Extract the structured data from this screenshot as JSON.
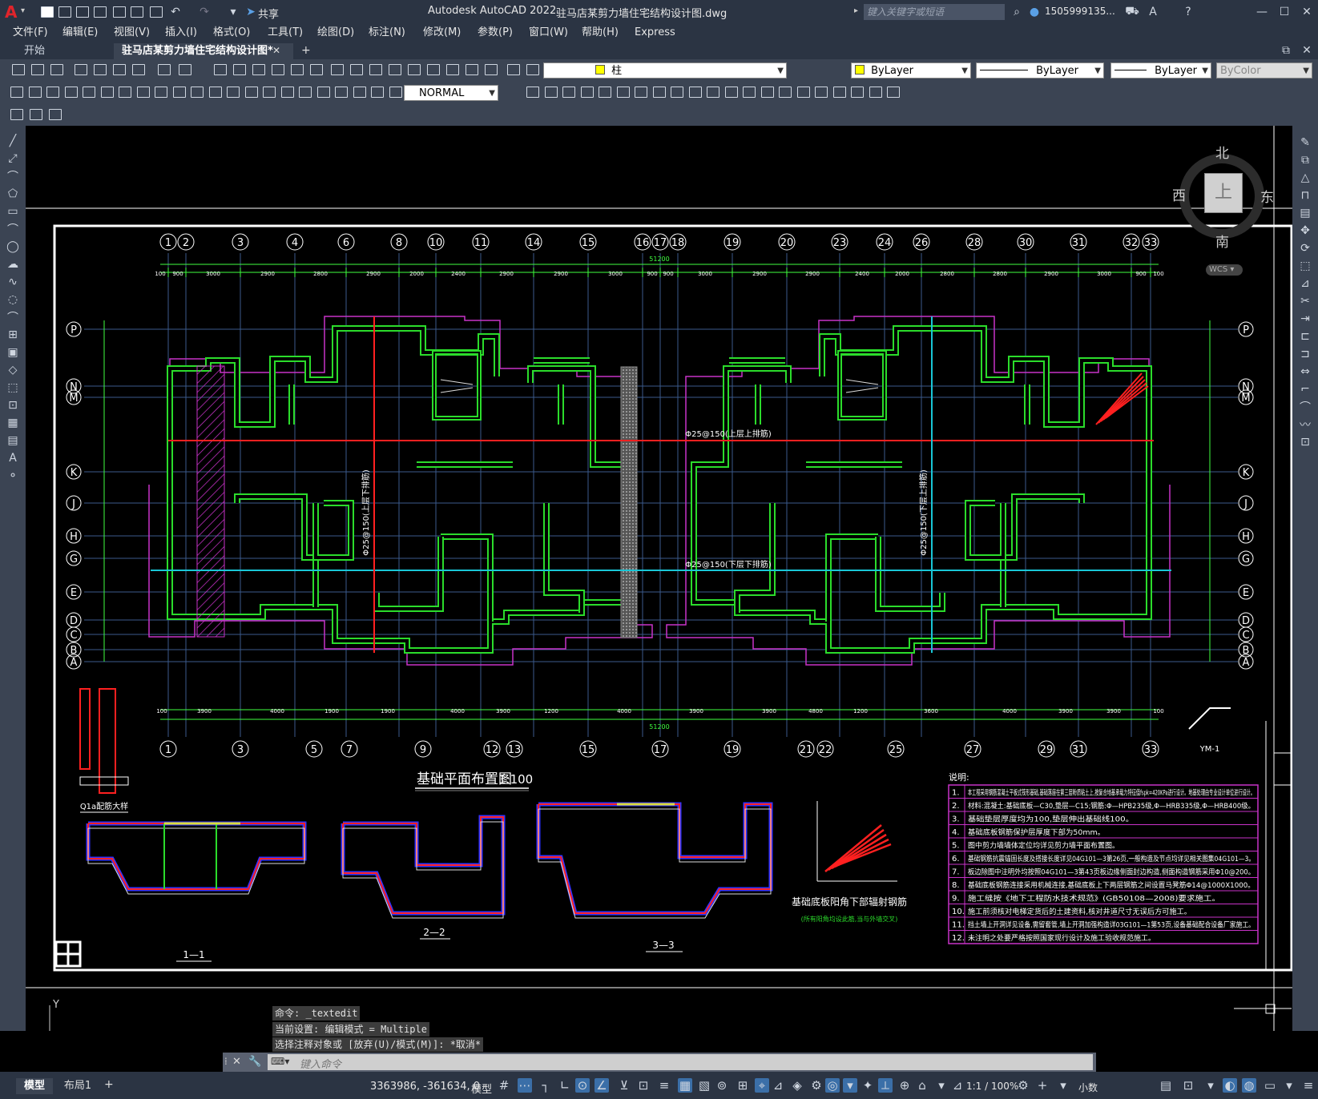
{
  "app": {
    "logo": "A",
    "title": "Autodesk AutoCAD 2022",
    "document_title": "驻马店某剪力墙住宅结构设计图.dwg",
    "share_label": "共享",
    "search_placeholder": "键入关键字或短语",
    "user_name": "1505999135...",
    "colors": {
      "titlebar": "#2b3443",
      "toolbar": "#3b4453",
      "canvas": "#000000",
      "accent": "#3b6fa8"
    }
  },
  "menu": [
    "文件(F)",
    "编辑(E)",
    "视图(V)",
    "插入(I)",
    "格式(O)",
    "工具(T)",
    "绘图(D)",
    "标注(N)",
    "修改(M)",
    "参数(P)",
    "窗口(W)",
    "帮助(H)",
    "Express"
  ],
  "tabs": [
    {
      "label": "开始",
      "active": false
    },
    {
      "label": "驻马店某剪力墙住宅结构设计图*",
      "active": true
    }
  ],
  "toolbar": {
    "layer_value": "柱",
    "color_value": "ByLayer",
    "linetype_value": "ByLayer",
    "lineweight_value": "ByLayer",
    "plotstyle_value": "ByColor",
    "dimstyle_value": "NORMAL"
  },
  "viewcube": {
    "north": "北",
    "south": "南",
    "east": "东",
    "west": "西",
    "top": "上",
    "wcs": "WCS"
  },
  "drawing": {
    "plan_title": "基础平面布置图",
    "plan_scale": "1:100",
    "top_axes": [
      "1",
      "2",
      "3",
      "4",
      "6",
      "8",
      "10",
      "11",
      "14",
      "15",
      "16",
      "17",
      "18",
      "19",
      "20",
      "23",
      "24",
      "26",
      "28",
      "30",
      "31",
      "32",
      "33"
    ],
    "bottom_axes": [
      "1",
      "3",
      "5",
      "7",
      "9",
      "12",
      "13",
      "15",
      "17",
      "19",
      "21",
      "22",
      "25",
      "27",
      "29",
      "31",
      "33"
    ],
    "row_axes": [
      "P",
      "N",
      "M",
      "K",
      "J",
      "H",
      "G",
      "E",
      "D",
      "C",
      "B",
      "A"
    ],
    "top_dims": [
      "100",
      "900",
      "3000",
      "2900",
      "2800",
      "2900",
      "2000",
      "2400",
      "2900",
      "2900",
      "3000",
      "900",
      "900",
      "3000",
      "2900",
      "2900",
      "2400",
      "2000",
      "2800",
      "2800",
      "2900",
      "3000",
      "900",
      "100"
    ],
    "bottom_dims": [
      "100",
      "3900",
      "4000",
      "1900",
      "1900",
      "4000",
      "3900",
      "1200",
      "4000",
      "3900",
      "3900",
      "4800",
      "1200",
      "3600",
      "4000",
      "3900",
      "3900",
      "100"
    ],
    "total_dim": "51200",
    "rebar_labels": [
      "Φ25@150(上层上排筋)",
      "Φ25@150(下层下排筋)",
      "Φ25@150(上层下排筋)",
      "Φ25@150(下层上排筋)"
    ],
    "sections": [
      "1—1",
      "2—2",
      "3—3"
    ],
    "corner_detail_title": "基础底板阳角下部辐射钢筋",
    "corner_detail_sub": "(所有阳角均设此筋,当与外墙交叉)",
    "q1a_title": "Q1a配筋大样",
    "ym_title": "YM-1",
    "notes_title": "说明:",
    "notes": [
      "本工程采用钢筋混凝土平板式筏形基础,基础落座在第三层粉质粘土上,按复合地基承载力特征值fspk=420KPa进行设计。地基处理由专业设计单位进行设计。",
      "材料:混凝土:基础底板—C30,垫层—C15;钢筋:Φ—HPB235级,Φ—HRB335级,Φ—HRB400级。",
      "基础垫层厚度均为100,垫层伸出基础线100。",
      "基础底板钢筋保护层厚度下部为50mm。",
      "图中剪力墙墙体定位均详见剪力墙平面布置图。",
      "基础钢筋抗震锚固长度及搭接长度详见04G101—3第26页,一般构造及节点均详见相关图集04G101—3。",
      "板边除图中注明外均按照04G101—3第43页板边缘侧面封边构造,侧面构造钢筋采用Φ10@200。",
      "基础底板钢筋连接采用机械连接,基础底板上下两层钢筋之间设置马凳筋Φ14@1000X1000。",
      "施工缝按《地下工程防水技术规范》(GB50108—2008)要求施工。",
      "施工前须核对电梯定货后的土建资料,核对井道尺寸无误后方可施工。",
      "挡土墙上开洞详见设备,需留套管,墙上开洞加强构造详03G101—1第53页,设备基础配合设备厂家施工。",
      "未注明之处要严格按照国家现行设计及施工验收规范施工。"
    ]
  },
  "command": {
    "history": [
      "命令: _textedit",
      "当前设置: 编辑模式 = Multiple",
      "选择注释对象或 [放弃(U)/模式(M)]: *取消*"
    ],
    "input_placeholder": "键入命令"
  },
  "status": {
    "layout_tabs": [
      "模型",
      "布局1"
    ],
    "coords": "3363986, -361634, 0",
    "model_label": "模型",
    "scale": "1:1 / 100%",
    "units": "小数"
  }
}
